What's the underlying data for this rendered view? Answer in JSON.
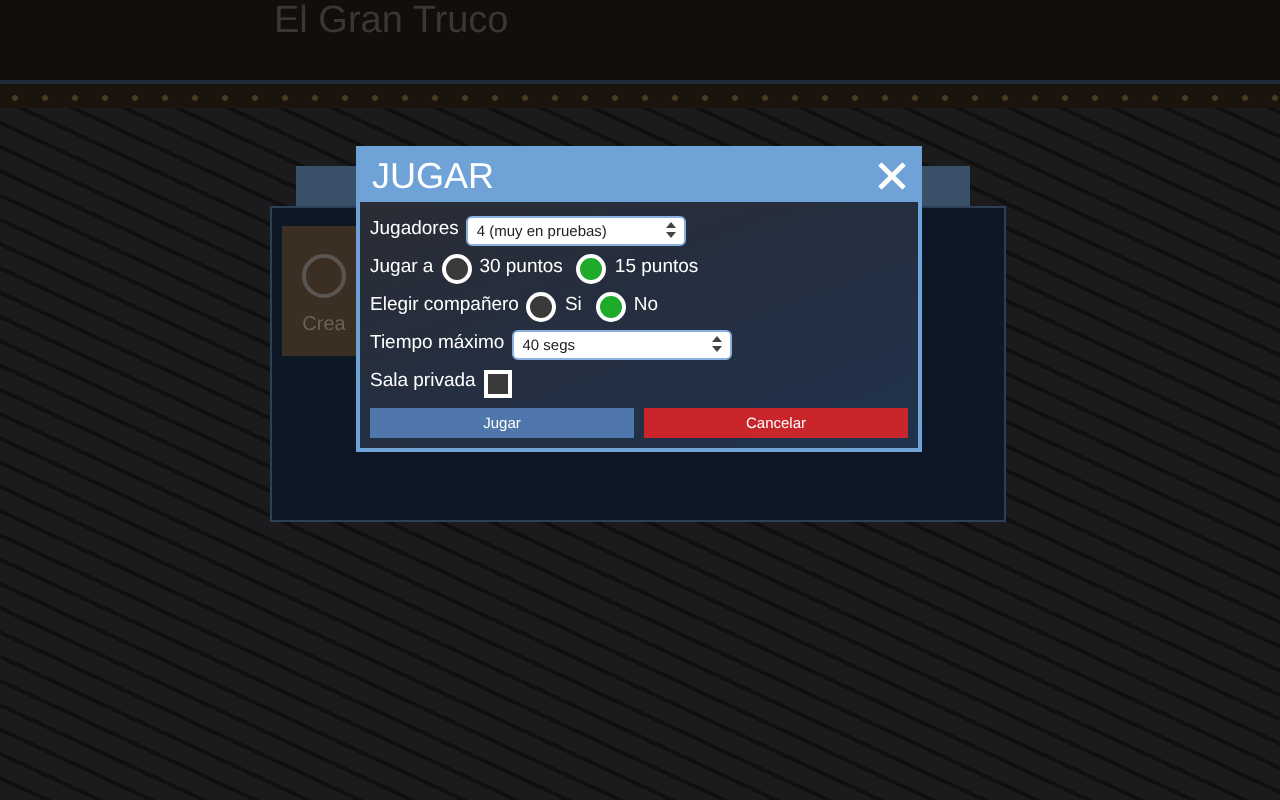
{
  "header": {
    "title": "El Gran Truco"
  },
  "background_card": {
    "text": "Crea"
  },
  "dialog": {
    "title": "JUGAR",
    "fields": [
      {
        "kind": "select",
        "label": "Jugadores",
        "value": "4 (muy en pruebas)"
      },
      {
        "kind": "radio",
        "label": "Jugar a",
        "options": [
          {
            "label": "30 puntos",
            "selected": false
          },
          {
            "label": "15 puntos",
            "selected": true
          }
        ]
      },
      {
        "kind": "radio",
        "label": "Elegir compañero",
        "options": [
          {
            "label": "Si",
            "selected": false
          },
          {
            "label": "No",
            "selected": true
          }
        ]
      },
      {
        "kind": "select",
        "label": "Tiempo máximo",
        "value": "40 segs"
      },
      {
        "kind": "checkbox",
        "label": "Sala privada",
        "checked": false
      }
    ],
    "buttons": [
      {
        "label": "Jugar",
        "kind": "primary"
      },
      {
        "label": "Cancelar",
        "kind": "danger"
      }
    ]
  }
}
